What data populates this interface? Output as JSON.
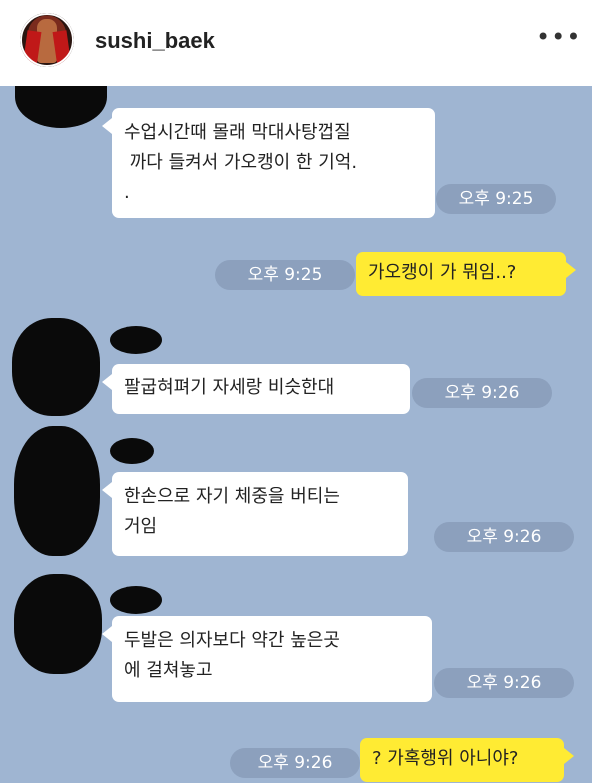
{
  "header": {
    "username": "sushi_baek",
    "more_icon": "more-horizontal-icon",
    "more_label": "•••"
  },
  "chat": {
    "background_color": "#9fb5d2",
    "messages": [
      {
        "sender": "other",
        "text": "수업시간때 몰래 막대사탕껍질\n 까다 들켜서 가오캥이 한 기억.\n.",
        "time": "오후 9:25"
      },
      {
        "sender": "me",
        "text": "가오캥이 가 뭐임..?",
        "time": "오후 9:25"
      },
      {
        "sender": "other",
        "text": "팔굽혀펴기 자세랑 비슷한대",
        "time": "오후 9:26"
      },
      {
        "sender": "other",
        "text": "한손으로 자기 체중을 버티는\n거임",
        "time": "오후 9:26"
      },
      {
        "sender": "other",
        "text": "두발은 의자보다 약간 높은곳\n에 걸쳐놓고",
        "time": "오후 9:26"
      },
      {
        "sender": "me",
        "text": "? 가혹행위 아니야?",
        "time": "오후 9:26"
      }
    ]
  }
}
